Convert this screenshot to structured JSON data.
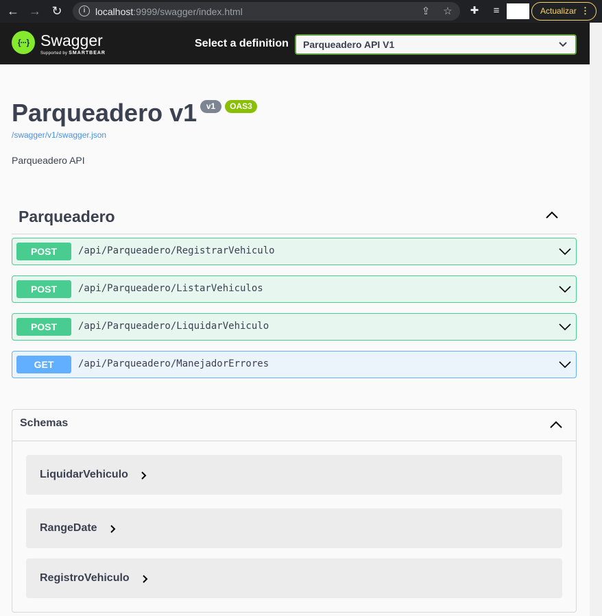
{
  "browser": {
    "url_host": "localhost",
    "url_rest": ":9999/swagger/index.html",
    "update_label": "Actualizar"
  },
  "topbar": {
    "logo_title": "Swagger",
    "logo_sub_prefix": "Supported by ",
    "logo_sub_brand": "SMARTBEAR",
    "select_label": "Select a definition",
    "selected_definition": "Parqueadero API V1"
  },
  "info": {
    "title": "Parqueadero v1",
    "version_badge": "v1",
    "oas_badge": "OAS3",
    "spec_link": "/swagger/v1/swagger.json",
    "description": "Parqueadero API"
  },
  "tag": {
    "name": "Parqueadero"
  },
  "operations": [
    {
      "method": "POST",
      "path": "/api/Parqueadero/RegistrarVehiculo"
    },
    {
      "method": "POST",
      "path": "/api/Parqueadero/ListarVehiculos"
    },
    {
      "method": "POST",
      "path": "/api/Parqueadero/LiquidarVehiculo"
    },
    {
      "method": "GET",
      "path": "/api/Parqueadero/ManejadorErrores"
    }
  ],
  "schemas": {
    "title": "Schemas",
    "models": [
      "LiquidarVehiculo",
      "RangeDate",
      "RegistroVehiculo"
    ]
  },
  "colors": {
    "post": "#49cc90",
    "get": "#61affe",
    "accent": "#85ea2d",
    "text": "#3b4151"
  }
}
